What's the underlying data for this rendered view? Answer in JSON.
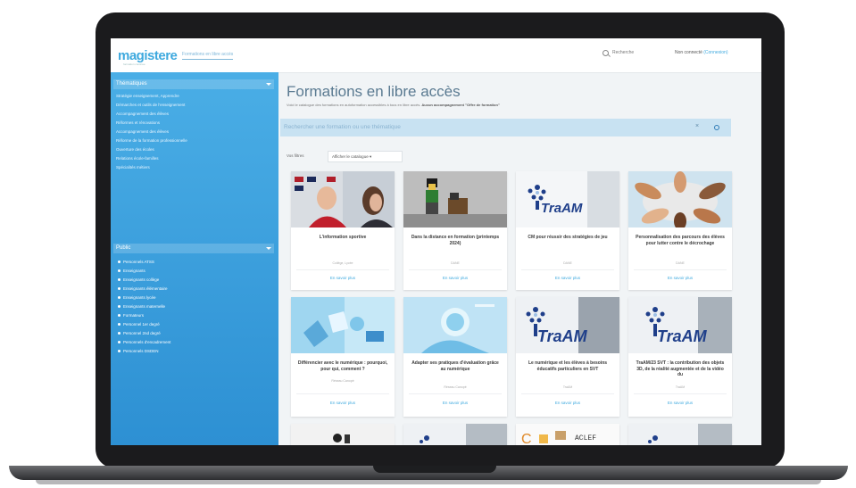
{
  "header": {
    "logo": "magistere",
    "logo_sub": "formation continue",
    "tab": "Formations en libre accès",
    "search": "Recherche",
    "account_prefix": "Non connecté",
    "account_link": "(Connexion)"
  },
  "sidebar": {
    "sections": [
      {
        "title": "Thématiques",
        "items": [
          "Stratégie enseignement, Apprendre",
          "Démarches et outils de l'enseignement",
          "Accompagnement des élèves",
          "Réformes et rénovations",
          "Accompagnement des élèves",
          "Réforme de la formation professionnelle",
          "Ouverture des écoles",
          "Relations école-familles",
          "Spécialités métiers"
        ]
      },
      {
        "title": "Public",
        "items": [
          "Personnels ATSS",
          "Enseignants",
          "Enseignants collège",
          "Enseignants élémentaire",
          "Enseignants lycée",
          "Enseignants maternelle",
          "Formateurs",
          "Personnel 1er degré",
          "Personnel 2nd degré",
          "Personnels d'encadrement",
          "Personnels DSDEN"
        ]
      }
    ]
  },
  "main": {
    "title": "Formations en libre accès",
    "subtitle_prefix": "Voici le catalogue des formations en autoformation accessibles à tous en libre accès. ",
    "subtitle_bold": "Aucun accompagnement \"Offre de formation\"",
    "search_placeholder": "Rechercher une formation ou une thématique",
    "search_clear": "×",
    "filters_label": "Vos filtres",
    "filter_button": "Afficher le catalogue ▾"
  },
  "cards": [
    {
      "title": "L'information sportive",
      "meta": "Collège, Lycée",
      "link": "En savoir plus",
      "thumb": "photo"
    },
    {
      "title": "Dans la distance en formation (printemps 2024)",
      "meta": "DANE",
      "link": "En savoir plus",
      "thumb": "lego"
    },
    {
      "title": "CM pour réussir des stratégies de jeu",
      "meta": "DANE",
      "link": "En savoir plus",
      "thumb": "traam-plain"
    },
    {
      "title": "Personnalisation des parcours des élèves pour lutter contre le décrochage",
      "meta": "DANE",
      "link": "En savoir plus",
      "thumb": "hands"
    },
    {
      "title": "Différencier avec le numérique : pourquoi, pour qui, comment ?",
      "meta": "Réseau Canopé",
      "link": "En savoir plus",
      "thumb": "blue-desk"
    },
    {
      "title": "Adapter ses pratiques d'évaluation grâce au numérique",
      "meta": "Réseau Canopé",
      "link": "En savoir plus",
      "thumb": "blue-hand"
    },
    {
      "title": "Le numérique et les élèves à besoins éducatifs particuliers en SVT",
      "meta": "TraAM",
      "link": "En savoir plus",
      "thumb": "traam-photo"
    },
    {
      "title": "TraAM/23 SVT : la contribution des objets 3D, de la réalité augmentée et de la vidéo du",
      "meta": "TraAM",
      "link": "En savoir plus",
      "thumb": "traam-photo"
    }
  ],
  "thumb_labels": {
    "traam": "TraAM",
    "bottom_strip": "ACLEF"
  },
  "colors": {
    "brand": "#3ea9de",
    "sidebar_top": "#4aaee6",
    "sidebar_bottom": "#2d90d3",
    "title": "#5a7a91",
    "searchbar": "#c8e2f2"
  }
}
